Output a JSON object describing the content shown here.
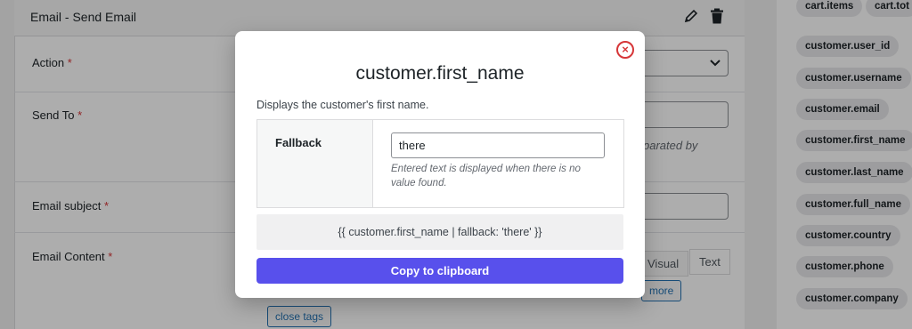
{
  "panel": {
    "title": "Email - Send Email",
    "edit_icon": "pencil-icon",
    "delete_icon": "trash-icon"
  },
  "form": {
    "action_label": "Action",
    "send_to_label": "Send To",
    "send_to_hint": "parated by",
    "subject_label": "Email subject",
    "content_label": "Email Content",
    "required_mark": "*",
    "tab_visual": "Visual",
    "tab_text": "Text",
    "quicktag_more": "more",
    "quicktag_close": "close tags"
  },
  "sidebar": {
    "top_chips": [
      "cart.items",
      "cart.tot"
    ],
    "variables": [
      "customer.user_id",
      "customer.username",
      "customer.email",
      "customer.first_name",
      "customer.last_name",
      "customer.full_name",
      "customer.country",
      "customer.phone",
      "customer.company"
    ]
  },
  "modal": {
    "title": "customer.first_name",
    "description": "Displays the customer's first name.",
    "fallback_label": "Fallback",
    "fallback_value": "there",
    "fallback_hint": "Entered text is displayed when there is no value found.",
    "preview": "{{ customer.first_name | fallback: 'there' }}",
    "copy_button": "Copy to clipboard",
    "close_icon": "close-circle-icon",
    "close_glyph": "×"
  },
  "colors": {
    "accent": "#5850ec",
    "danger": "#d63638"
  }
}
